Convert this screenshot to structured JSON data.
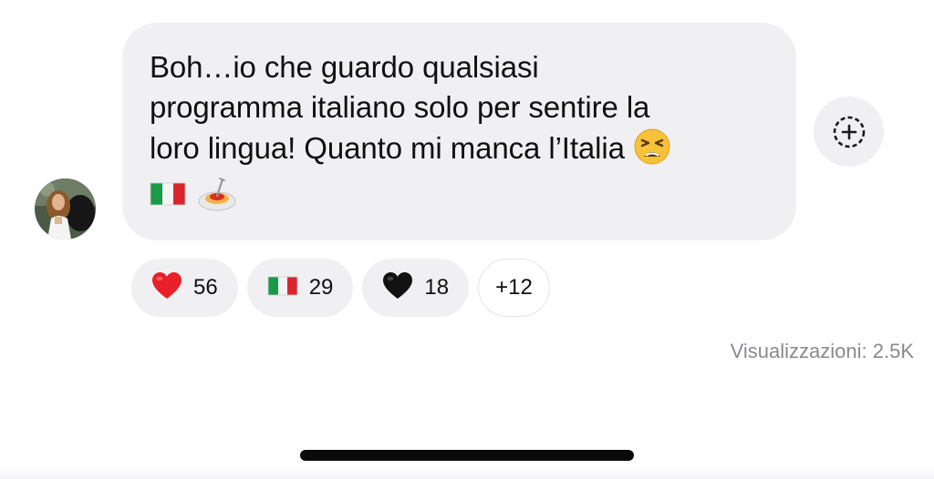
{
  "message": {
    "lines": [
      "Boh…io che guardo qualsiasi",
      "programma italiano solo per sentire la",
      "loro lingua! Quanto mi manca l’Italia"
    ],
    "end_emoji": "tired-face-emoji",
    "trailing_emojis": [
      "italy-flag-emoji",
      "spaghetti-emoji"
    ]
  },
  "reactions": [
    {
      "icon": "red-heart-emoji",
      "count": "56"
    },
    {
      "icon": "italy-flag-emoji",
      "count": "29"
    },
    {
      "icon": "black-heart-emoji",
      "count": "18"
    }
  ],
  "more_reactions": "+12",
  "views": "Visualizzazioni: 2.5K",
  "colors": {
    "bubble": "#f0f0f2",
    "text": "#101010",
    "muted": "#8a8a8e",
    "heart": "#e8202a",
    "flag_green": "#1a9a48",
    "flag_red": "#d8262e"
  }
}
